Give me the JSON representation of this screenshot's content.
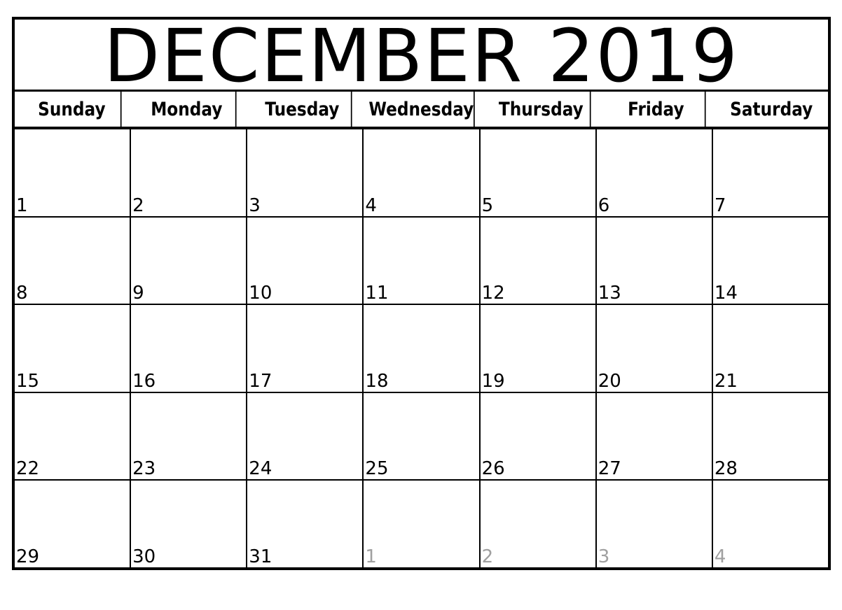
{
  "calendar": {
    "title": "DECEMBER 2019",
    "weekdays": [
      "Sunday",
      "Monday",
      "Tuesday",
      "Wednesday",
      "Thursday",
      "Friday",
      "Saturday"
    ],
    "weeks": [
      [
        {
          "day": "1",
          "other": false
        },
        {
          "day": "2",
          "other": false
        },
        {
          "day": "3",
          "other": false
        },
        {
          "day": "4",
          "other": false
        },
        {
          "day": "5",
          "other": false
        },
        {
          "day": "6",
          "other": false
        },
        {
          "day": "7",
          "other": false
        }
      ],
      [
        {
          "day": "8",
          "other": false
        },
        {
          "day": "9",
          "other": false
        },
        {
          "day": "10",
          "other": false
        },
        {
          "day": "11",
          "other": false
        },
        {
          "day": "12",
          "other": false
        },
        {
          "day": "13",
          "other": false
        },
        {
          "day": "14",
          "other": false
        }
      ],
      [
        {
          "day": "15",
          "other": false
        },
        {
          "day": "16",
          "other": false
        },
        {
          "day": "17",
          "other": false
        },
        {
          "day": "18",
          "other": false
        },
        {
          "day": "19",
          "other": false
        },
        {
          "day": "20",
          "other": false
        },
        {
          "day": "21",
          "other": false
        }
      ],
      [
        {
          "day": "22",
          "other": false
        },
        {
          "day": "23",
          "other": false
        },
        {
          "day": "24",
          "other": false
        },
        {
          "day": "25",
          "other": false
        },
        {
          "day": "26",
          "other": false
        },
        {
          "day": "27",
          "other": false
        },
        {
          "day": "28",
          "other": false
        }
      ],
      [
        {
          "day": "29",
          "other": false
        },
        {
          "day": "30",
          "other": false
        },
        {
          "day": "31",
          "other": false
        },
        {
          "day": "1",
          "other": true
        },
        {
          "day": "2",
          "other": true
        },
        {
          "day": "3",
          "other": true
        },
        {
          "day": "4",
          "other": true
        }
      ]
    ],
    "colors": {
      "line": "#000000",
      "current_month_text": "#000000",
      "other_month_text": "#a0a0a0"
    }
  }
}
